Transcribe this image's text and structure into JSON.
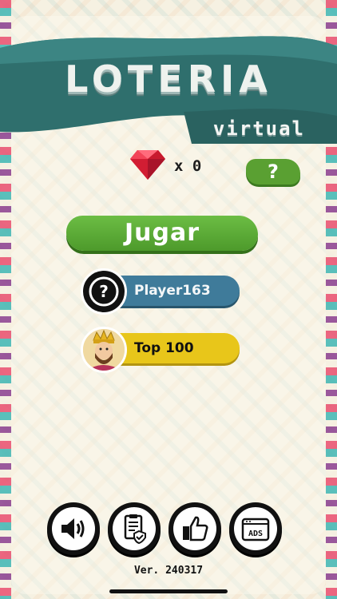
{
  "header": {
    "title": "LOTERIA",
    "subtitle": "virtual"
  },
  "gems": {
    "icon": "gem-icon",
    "count": "x 0",
    "color": "#e8243a"
  },
  "help": {
    "label": "?"
  },
  "menu": {
    "play_label": "Jugar",
    "player_name": "Player163",
    "top_label": "Top 100"
  },
  "bottom_bar": [
    {
      "icon": "sound-icon"
    },
    {
      "icon": "privacy-policy-icon"
    },
    {
      "icon": "like-icon"
    },
    {
      "icon": "ads-icon",
      "label": "ADS"
    }
  ],
  "version": "Ver. 240317",
  "colors": {
    "banner": "#2f6f6d",
    "play_button": "#5aa032",
    "player_pill": "#3f7b9a",
    "top_pill": "#e8c61a"
  }
}
